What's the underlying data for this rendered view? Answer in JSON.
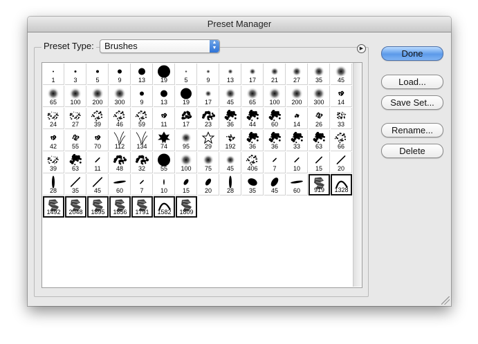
{
  "window": {
    "title": "Preset Manager"
  },
  "preset_type": {
    "label": "Preset Type:",
    "value": "Brushes"
  },
  "buttons": {
    "done": "Done",
    "load": "Load...",
    "save_set": "Save Set...",
    "rename": "Rename...",
    "delete": "Delete"
  },
  "brushes": [
    {
      "size": "1",
      "kind": "hard",
      "r": 1
    },
    {
      "size": "3",
      "kind": "hard",
      "r": 1.5
    },
    {
      "size": "5",
      "kind": "hard",
      "r": 2
    },
    {
      "size": "9",
      "kind": "hard",
      "r": 3
    },
    {
      "size": "13",
      "kind": "hard",
      "r": 5
    },
    {
      "size": "19",
      "kind": "hard",
      "r": 9
    },
    {
      "size": "5",
      "kind": "soft",
      "r": 2
    },
    {
      "size": "9",
      "kind": "soft",
      "r": 3
    },
    {
      "size": "13",
      "kind": "soft",
      "r": 4
    },
    {
      "size": "17",
      "kind": "soft",
      "r": 5
    },
    {
      "size": "21",
      "kind": "soft",
      "r": 6
    },
    {
      "size": "27",
      "kind": "soft",
      "r": 7
    },
    {
      "size": "35",
      "kind": "soft",
      "r": 8
    },
    {
      "size": "45",
      "kind": "soft",
      "r": 9
    },
    {
      "size": "65",
      "kind": "soft",
      "r": 9
    },
    {
      "size": "100",
      "kind": "soft",
      "r": 9
    },
    {
      "size": "200",
      "kind": "soft",
      "r": 9
    },
    {
      "size": "300",
      "kind": "soft",
      "r": 9
    },
    {
      "size": "9",
      "kind": "hard",
      "r": 3
    },
    {
      "size": "13",
      "kind": "hard",
      "r": 5
    },
    {
      "size": "19",
      "kind": "hard",
      "r": 8
    },
    {
      "size": "17",
      "kind": "soft",
      "r": 5
    },
    {
      "size": "45",
      "kind": "soft",
      "r": 8
    },
    {
      "size": "65",
      "kind": "soft",
      "r": 9
    },
    {
      "size": "100",
      "kind": "soft",
      "r": 9
    },
    {
      "size": "200",
      "kind": "soft",
      "r": 9
    },
    {
      "size": "300",
      "kind": "soft",
      "r": 9
    },
    {
      "size": "14",
      "kind": "splatter",
      "r": 4
    },
    {
      "size": "24",
      "kind": "splatter",
      "r": 8
    },
    {
      "size": "27",
      "kind": "splatter",
      "r": 8
    },
    {
      "size": "39",
      "kind": "splatter",
      "r": 9
    },
    {
      "size": "46",
      "kind": "splatter",
      "r": 9
    },
    {
      "size": "59",
      "kind": "splatter",
      "r": 9
    },
    {
      "size": "11",
      "kind": "splatter",
      "r": 4
    },
    {
      "size": "17",
      "kind": "blob",
      "r": 7
    },
    {
      "size": "23",
      "kind": "blob",
      "r": 8
    },
    {
      "size": "36",
      "kind": "blob",
      "r": 9
    },
    {
      "size": "44",
      "kind": "blob",
      "r": 9
    },
    {
      "size": "60",
      "kind": "blob",
      "r": 9
    },
    {
      "size": "14",
      "kind": "splatter",
      "r": 3
    },
    {
      "size": "26",
      "kind": "splatter",
      "r": 5
    },
    {
      "size": "33",
      "kind": "splatter",
      "r": 7
    },
    {
      "size": "42",
      "kind": "splatter",
      "r": 4
    },
    {
      "size": "55",
      "kind": "splatter",
      "r": 5
    },
    {
      "size": "70",
      "kind": "splatter",
      "r": 4
    },
    {
      "size": "112",
      "kind": "grass",
      "r": 9
    },
    {
      "size": "134",
      "kind": "grass",
      "r": 9
    },
    {
      "size": "74",
      "kind": "leaf",
      "r": 9
    },
    {
      "size": "95",
      "kind": "soft",
      "r": 8
    },
    {
      "size": "29",
      "kind": "star",
      "r": 9
    },
    {
      "size": "192",
      "kind": "splatter",
      "r": 6
    },
    {
      "size": "36",
      "kind": "blob",
      "r": 9
    },
    {
      "size": "36",
      "kind": "blob",
      "r": 9
    },
    {
      "size": "33",
      "kind": "blob",
      "r": 9
    },
    {
      "size": "63",
      "kind": "blob",
      "r": 9
    },
    {
      "size": "66",
      "kind": "splatter",
      "r": 9
    },
    {
      "size": "39",
      "kind": "splatter",
      "r": 8
    },
    {
      "size": "63",
      "kind": "blob",
      "r": 9
    },
    {
      "size": "11",
      "kind": "stroke",
      "r": 4
    },
    {
      "size": "48",
      "kind": "blob",
      "r": 8
    },
    {
      "size": "32",
      "kind": "blob",
      "r": 8
    },
    {
      "size": "55",
      "kind": "hard",
      "r": 9
    },
    {
      "size": "100",
      "kind": "soft",
      "r": 9
    },
    {
      "size": "75",
      "kind": "soft",
      "r": 8
    },
    {
      "size": "45",
      "kind": "soft",
      "r": 7
    },
    {
      "size": "406",
      "kind": "splatter",
      "r": 9
    },
    {
      "size": "7",
      "kind": "stroke",
      "r": 3
    },
    {
      "size": "10",
      "kind": "stroke",
      "r": 4
    },
    {
      "size": "15",
      "kind": "stroke",
      "r": 6
    },
    {
      "size": "20",
      "kind": "stroke",
      "r": 8
    },
    {
      "size": "28",
      "kind": "ellipse-v",
      "r": 9
    },
    {
      "size": "35",
      "kind": "stroke",
      "r": 9
    },
    {
      "size": "45",
      "kind": "stroke",
      "r": 9
    },
    {
      "size": "60",
      "kind": "stroke-h",
      "r": 9
    },
    {
      "size": "7",
      "kind": "stroke",
      "r": 3
    },
    {
      "size": "10",
      "kind": "ellipse-v",
      "r": 4
    },
    {
      "size": "15",
      "kind": "ellipse",
      "r": 6
    },
    {
      "size": "20",
      "kind": "ellipse",
      "r": 7
    },
    {
      "size": "28",
      "kind": "ellipse-v",
      "r": 9
    },
    {
      "size": "35",
      "kind": "ellipse-big",
      "r": 9
    },
    {
      "size": "45",
      "kind": "ellipse",
      "r": 9
    },
    {
      "size": "60",
      "kind": "stroke-h",
      "r": 9
    },
    {
      "size": "919",
      "kind": "art",
      "r": 9
    },
    {
      "size": "1328",
      "kind": "arc",
      "r": 9
    },
    {
      "size": "1492",
      "kind": "art",
      "r": 9
    },
    {
      "size": "2048",
      "kind": "art",
      "r": 9
    },
    {
      "size": "1895",
      "kind": "art",
      "r": 9
    },
    {
      "size": "1856",
      "kind": "art",
      "r": 9
    },
    {
      "size": "1791",
      "kind": "art",
      "r": 9
    },
    {
      "size": "1582",
      "kind": "arc",
      "r": 9
    },
    {
      "size": "1809",
      "kind": "art",
      "r": 9
    }
  ],
  "colors": {
    "primary_button": "#5c9ae9",
    "brush_ink": "#000000",
    "grid_background": "#ffffff"
  }
}
